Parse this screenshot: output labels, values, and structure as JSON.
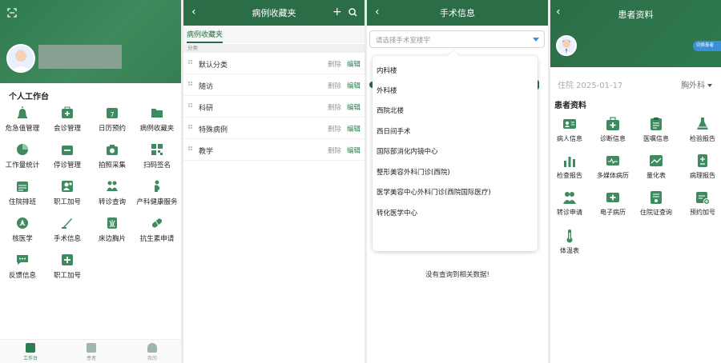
{
  "screen1": {
    "section_title": "个人工作台",
    "items": [
      {
        "label": "危急值管理",
        "icon": "alarm-icon"
      },
      {
        "label": "会诊管理",
        "icon": "medical-kit-icon"
      },
      {
        "label": "日历预约",
        "icon": "calendar-icon"
      },
      {
        "label": "病例收藏夹",
        "icon": "folder-icon"
      },
      {
        "label": "工作量统计",
        "icon": "pie-chart-icon"
      },
      {
        "label": "停诊管理",
        "icon": "stop-clinic-icon"
      },
      {
        "label": "拍照采集",
        "icon": "camera-icon"
      },
      {
        "label": "扫码签名",
        "icon": "qr-code-icon"
      },
      {
        "label": "住院排班",
        "icon": "schedule-icon"
      },
      {
        "label": "职工加号",
        "icon": "staff-add-icon"
      },
      {
        "label": "转诊查询",
        "icon": "referral-icon"
      },
      {
        "label": "产科健康服务",
        "icon": "maternity-icon"
      },
      {
        "label": "核医学",
        "icon": "radiation-icon"
      },
      {
        "label": "手术信息",
        "icon": "scalpel-icon"
      },
      {
        "label": "床边胸片",
        "icon": "xray-icon"
      },
      {
        "label": "抗生素申请",
        "icon": "pill-icon"
      },
      {
        "label": "反馈信息",
        "icon": "message-icon"
      },
      {
        "label": "职工加号",
        "icon": "plus-box-icon"
      }
    ],
    "tabs": [
      {
        "label": "工作台",
        "active": true
      },
      {
        "label": "患者",
        "active": false
      },
      {
        "label": "我的",
        "active": false
      }
    ]
  },
  "screen2": {
    "title": "病例收藏夹",
    "add_icon": "+",
    "tab": "病例收藏夹",
    "section_label": "分类",
    "rows": [
      {
        "name": "默认分类"
      },
      {
        "name": "随访"
      },
      {
        "name": "科研"
      },
      {
        "name": "特殊病例"
      },
      {
        "name": "教学"
      }
    ],
    "delete_label": "删除",
    "edit_label": "编辑"
  },
  "screen3": {
    "title": "手术信息",
    "select_placeholder": "请选择手术室楼宇",
    "options": [
      "内科楼",
      "外科楼",
      "西院北楼",
      "西日间手术",
      "国际部消化内镜中心",
      "整形美容外科门诊(西院)",
      "医学美容中心外科门诊(西院国际医疗)",
      "转化医学中心"
    ],
    "empty_text": "没有查询到相关数据!"
  },
  "screen4": {
    "title": "患者资料",
    "switch_label": "切换患者",
    "admission_info": "住院 2025-01-17",
    "dept": "胸外科",
    "section_title": "患者资料",
    "items": [
      {
        "label": "病人信息",
        "icon": "id-card-icon"
      },
      {
        "label": "诊断信息",
        "icon": "medical-kit-icon"
      },
      {
        "label": "医嘱信息",
        "icon": "clipboard-icon"
      },
      {
        "label": "检验报告",
        "icon": "flask-icon"
      },
      {
        "label": "检查报告",
        "icon": "bar-chart-icon"
      },
      {
        "label": "多媒体病历",
        "icon": "media-icon"
      },
      {
        "label": "量化表",
        "icon": "trend-icon"
      },
      {
        "label": "病理报告",
        "icon": "report-icon"
      },
      {
        "label": "转诊申请",
        "icon": "transfer-icon"
      },
      {
        "label": "电子病历",
        "icon": "emr-icon"
      },
      {
        "label": "住院证查询",
        "icon": "certificate-icon"
      },
      {
        "label": "预约加号",
        "icon": "appointment-icon"
      },
      {
        "label": "体温表",
        "icon": "thermometer-icon"
      }
    ]
  },
  "colors": {
    "brand_green": "#2a6d47",
    "accent_green": "#2e7d52",
    "accent_blue": "#3a8fd6"
  }
}
